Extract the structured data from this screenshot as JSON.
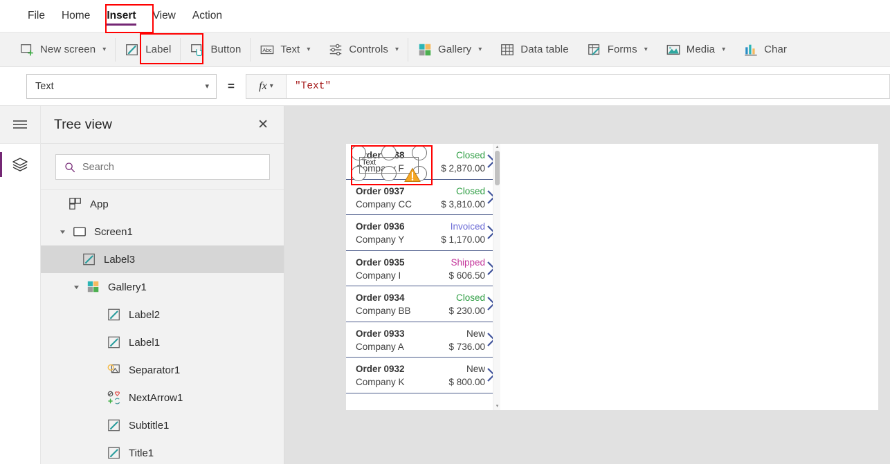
{
  "menu": {
    "items": [
      {
        "label": "File",
        "active": false
      },
      {
        "label": "Home",
        "active": false
      },
      {
        "label": "Insert",
        "active": true
      },
      {
        "label": "View",
        "active": false
      },
      {
        "label": "Action",
        "active": false
      }
    ],
    "active_accent": "#742774"
  },
  "ribbon": {
    "items": [
      {
        "label": "New screen",
        "icon": "new-screen-icon",
        "caret": true,
        "highlighted": false
      },
      {
        "label": "Label",
        "icon": "label-icon",
        "caret": false,
        "highlighted": true
      },
      {
        "label": "Button",
        "icon": "button-icon",
        "caret": false,
        "highlighted": false
      },
      {
        "label": "Text",
        "icon": "text-abc-icon",
        "caret": true,
        "highlighted": false
      },
      {
        "label": "Controls",
        "icon": "controls-icon",
        "caret": true,
        "highlighted": false
      },
      {
        "label": "Gallery",
        "icon": "gallery-icon",
        "caret": true,
        "highlighted": false
      },
      {
        "label": "Data table",
        "icon": "data-table-icon",
        "caret": false,
        "highlighted": false
      },
      {
        "label": "Forms",
        "icon": "forms-icon",
        "caret": true,
        "highlighted": false
      },
      {
        "label": "Media",
        "icon": "media-icon",
        "caret": true,
        "highlighted": false
      },
      {
        "label": "Char",
        "icon": "charts-icon",
        "caret": false,
        "highlighted": false
      }
    ]
  },
  "formula_bar": {
    "property": "Text",
    "equals": "=",
    "fx_label": "fx",
    "formula": "\"Text\""
  },
  "rail": {
    "hamburger": "hamburger-icon",
    "active_tool": "tree-view-layers-icon",
    "accent": "#742774"
  },
  "tree": {
    "title": "Tree view",
    "close_label": "✕",
    "search": {
      "placeholder": "Search",
      "value": ""
    },
    "nodes": [
      {
        "label": "App",
        "icon": "app-icon",
        "level": 1,
        "twisty": "none",
        "selected": false
      },
      {
        "label": "Screen1",
        "icon": "screen-icon",
        "level": 2,
        "twisty": "expanded",
        "selected": false
      },
      {
        "label": "Label3",
        "icon": "label-icon",
        "level": 3,
        "twisty": "none",
        "selected": true
      },
      {
        "label": "Gallery1",
        "icon": "gallery-icon",
        "level": 4,
        "twisty": "expanded",
        "selected": false
      },
      {
        "label": "Label2",
        "icon": "label-icon",
        "level": 5,
        "twisty": "none",
        "selected": false
      },
      {
        "label": "Label1",
        "icon": "label-icon",
        "level": 5,
        "twisty": "none",
        "selected": false
      },
      {
        "label": "Separator1",
        "icon": "separator-icon",
        "level": 5,
        "twisty": "none",
        "selected": false
      },
      {
        "label": "NextArrow1",
        "icon": "nextarrow-icon",
        "level": 5,
        "twisty": "none",
        "selected": false
      },
      {
        "label": "Subtitle1",
        "icon": "label-icon",
        "level": 5,
        "twisty": "none",
        "selected": false
      },
      {
        "label": "Title1",
        "icon": "label-icon",
        "level": 5,
        "twisty": "none",
        "selected": false
      }
    ]
  },
  "canvas": {
    "selected_control": {
      "text": "Text",
      "has_warning": true,
      "warning_icon": "warning-triangle-icon"
    },
    "gallery": {
      "rows": [
        {
          "order": "Order 0938",
          "company": "Company F",
          "status": "Closed",
          "status_color": "#2f9e44",
          "amount": "$ 2,870.00"
        },
        {
          "order": "Order 0937",
          "company": "Company CC",
          "status": "Closed",
          "status_color": "#2f9e44",
          "amount": "$ 3,810.00"
        },
        {
          "order": "Order 0936",
          "company": "Company Y",
          "status": "Invoiced",
          "status_color": "#6b6bd6",
          "amount": "$ 1,170.00"
        },
        {
          "order": "Order 0935",
          "company": "Company I",
          "status": "Shipped",
          "status_color": "#c5399c",
          "amount": "$ 606.50"
        },
        {
          "order": "Order 0934",
          "company": "Company BB",
          "status": "Closed",
          "status_color": "#2f9e44",
          "amount": "$ 230.00"
        },
        {
          "order": "Order 0933",
          "company": "Company A",
          "status": "New",
          "status_color": "#3f3f3f",
          "amount": "$ 736.00"
        },
        {
          "order": "Order 0932",
          "company": "Company K",
          "status": "New",
          "status_color": "#3f3f3f",
          "amount": "$ 800.00"
        }
      ],
      "next_icon": "chevron-right-icon",
      "scrollbar": {
        "up_arrow": "▴",
        "down_arrow": "▾"
      }
    }
  }
}
